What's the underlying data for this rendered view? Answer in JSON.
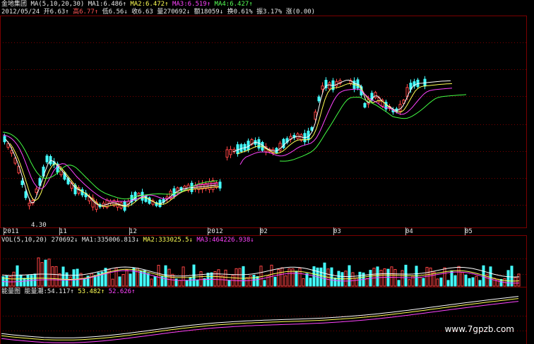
{
  "header": {
    "line1": {
      "stock": "金地集团",
      "ma_label": "MA(5,10,20,30)",
      "ma1": "MA1:6.486↑",
      "ma2": "MA2:6.472↑",
      "ma3": "MA3:6.519↑",
      "ma4": "MA4:6.427↑"
    },
    "line2": {
      "date": "2012/05/24",
      "open": "开6.63↑",
      "high": "高6.77↑",
      "low": "低6.56↓",
      "close": "收6.63",
      "volume": "量270692↓",
      "amount": "额18059↓",
      "turnover": "换0.61%",
      "amplitude": "振3.17%",
      "change": "涨(0.00)"
    }
  },
  "colors": {
    "up": "#ff4444",
    "down": "#44ffff",
    "ma1": "#ffffff",
    "ma2": "#ffff55",
    "ma3": "#ff44ff",
    "ma4": "#44ff44",
    "grid": "#7a0000",
    "bg": "#000000"
  },
  "chart_data": [
    {
      "type": "candlestick",
      "title": "",
      "annotations": [
        "4.30"
      ],
      "x_ticks": [
        "2011",
        "11",
        "12",
        "2012",
        "02",
        "03",
        "04",
        "05"
      ]
    },
    {
      "type": "bar",
      "title": "VOL(5,10,20)",
      "legend": [
        "270692↓",
        "MA1:335006.813↓",
        "MA2:333025.5↓",
        "MA3:464226.938↓"
      ]
    },
    {
      "type": "line",
      "title": "能量图",
      "legend": [
        "能量潮:54.117↑",
        "53.482↑",
        "52.626↑"
      ]
    }
  ],
  "watermark": "www.7gpzb.com"
}
